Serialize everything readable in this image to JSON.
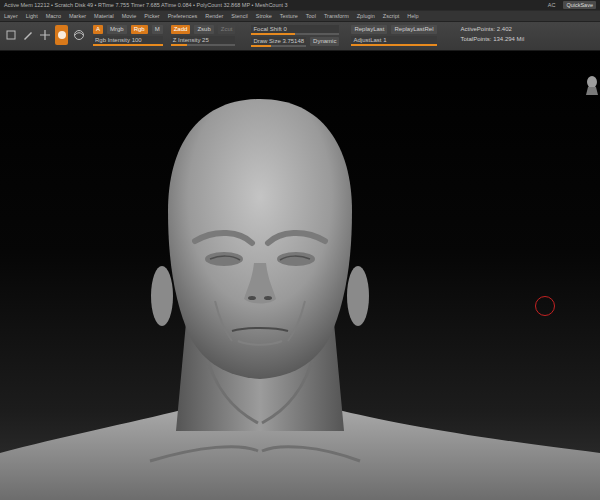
{
  "status_bar": {
    "text": "Active Mem 12212 • Scratch Disk 49 • RTime 7.755 Timer 7.685 ATime 0.084 • PolyCount 32.868 MP • MeshCount 3",
    "right": [
      "AC",
      "QuickSave"
    ]
  },
  "menu": [
    "Layer",
    "Light",
    "Macro",
    "Marker",
    "Material",
    "Movie",
    "Picker",
    "Preferences",
    "Render",
    "Stencil",
    "Stroke",
    "Texture",
    "Tool",
    "Transform",
    "Zplugin",
    "Zscript",
    "Help"
  ],
  "toolbar": {
    "tools": [
      {
        "selected": false
      },
      {
        "selected": false
      },
      {
        "selected": false
      },
      {
        "selected": true
      },
      {
        "selected": false
      }
    ],
    "channels": [
      {
        "label": "A",
        "selected": true
      },
      {
        "label": "Mrgb",
        "selected": false
      },
      {
        "label": "Rgb",
        "selected": true
      },
      {
        "label": "M",
        "selected": false
      }
    ],
    "sculpt_modes": [
      {
        "label": "Zadd",
        "selected": true,
        "disabled": false
      },
      {
        "label": "Zsub",
        "selected": false,
        "disabled": false
      },
      {
        "label": "Zcut",
        "selected": false,
        "disabled": true
      }
    ],
    "rgb_intensity": {
      "label": "Rgb Intensity 100",
      "level": 1.0
    },
    "z_intensity": {
      "label": "Z Intensity 25",
      "level": 0.25
    },
    "focal_shift": {
      "label": "Focal Shift 0",
      "level": 0.5
    },
    "draw_size": {
      "label": "Draw Size 3.75148",
      "level": 0.35
    },
    "dynamic": "Dynamic",
    "replay": [
      "ReplayLast",
      "ReplayLastRel"
    ],
    "adjust_last": {
      "label": "AdjustLast 1",
      "level": 1.0
    },
    "stats": [
      "ActivePoints: 2.402",
      "TotalPoints: 134.294 Mil"
    ]
  }
}
